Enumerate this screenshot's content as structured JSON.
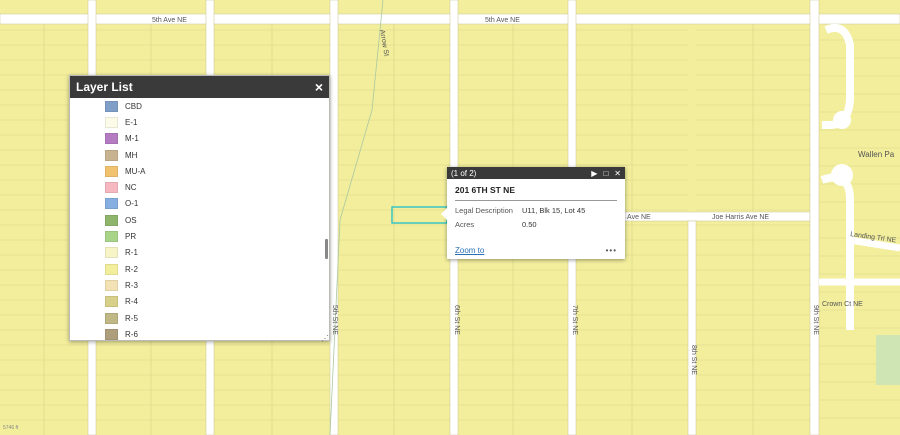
{
  "streets": {
    "fifth_ave_left": "5th Ave NE",
    "fifth_ave_right": "5th Ave NE",
    "joe_harris_left": "s Ave NE",
    "joe_harris_right": "Joe Harris Ave NE",
    "sixth_st": "6th St NE",
    "seventh_st": "7th St NE",
    "eighth_st": "8th St NE",
    "fifth_st": "5th St NE",
    "ninth_st": "9th St NE",
    "landing_trl": "Landing Trl NE",
    "crown_ct": "Crown Ct NE",
    "wallen_park": "Wallen Pa",
    "arrow_left": "Arrow St"
  },
  "colors": {
    "zone_r2": "#f2ee9c",
    "road": "#ffffff",
    "parcel_line": "#d8d48a",
    "park_green": "#cfe6b4",
    "selected_outline": "#2ec4c4",
    "dark_header": "#3a3a3a"
  },
  "layer_list": {
    "title": "Layer List",
    "close_icon": "×",
    "items": [
      {
        "label": "CBD",
        "color": "#7f9fc8"
      },
      {
        "label": "E-1",
        "color": "#fbfbe8"
      },
      {
        "label": "M-1",
        "color": "#b57bc2"
      },
      {
        "label": "MH",
        "color": "#c8b390"
      },
      {
        "label": "MU-A",
        "color": "#f2c36e"
      },
      {
        "label": "NC",
        "color": "#f5b8c0"
      },
      {
        "label": "O-1",
        "color": "#86aee0"
      },
      {
        "label": "OS",
        "color": "#8fb56d"
      },
      {
        "label": "PR",
        "color": "#a8d48a"
      },
      {
        "label": "R-1",
        "color": "#f7f5c8"
      },
      {
        "label": "R-2",
        "color": "#f2ee9c"
      },
      {
        "label": "R-3",
        "color": "#f3e2b4"
      },
      {
        "label": "R-4",
        "color": "#d8d088"
      },
      {
        "label": "R-5",
        "color": "#bfb784"
      },
      {
        "label": "R-6",
        "color": "#ae9e7c"
      }
    ]
  },
  "popup": {
    "counter": "(1 of 2)",
    "next_icon": "▶",
    "maximize_icon": "□",
    "close_icon": "✕",
    "title": "201 6TH ST NE",
    "fields": [
      {
        "key": "Legal Description",
        "value": "U11, Blk 15, Lot 45"
      },
      {
        "key": "Acres",
        "value": "0.50"
      }
    ],
    "zoom_label": "Zoom to",
    "more_label": "•••"
  },
  "scale_text": "5746 ft"
}
